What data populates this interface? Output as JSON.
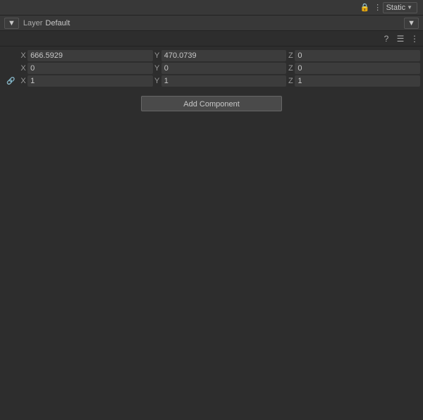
{
  "topBar": {
    "lockIcon": "🔒",
    "moreIcon": "⋮",
    "staticLabel": "Static",
    "staticArrow": "▾"
  },
  "layerBar": {
    "leftArrow": "▾",
    "layerLabel": "Layer",
    "layerValue": "Default",
    "rightArrow": "▾"
  },
  "toolbar": {
    "helpIcon": "?",
    "settingsIcon": "≡",
    "moreIcon": "⋮"
  },
  "transform": {
    "rows": [
      {
        "icon": "",
        "fields": [
          {
            "axis": "X",
            "value": "666.5929"
          },
          {
            "axis": "Y",
            "value": "470.0739"
          },
          {
            "axis": "Z",
            "value": "0"
          }
        ]
      },
      {
        "icon": "",
        "fields": [
          {
            "axis": "X",
            "value": "0"
          },
          {
            "axis": "Y",
            "value": "0"
          },
          {
            "axis": "Z",
            "value": "0"
          }
        ]
      },
      {
        "icon": "🔗",
        "fields": [
          {
            "axis": "X",
            "value": "1"
          },
          {
            "axis": "Y",
            "value": "1"
          },
          {
            "axis": "Z",
            "value": "1"
          }
        ]
      }
    ]
  },
  "addComponent": {
    "label": "Add Component"
  }
}
